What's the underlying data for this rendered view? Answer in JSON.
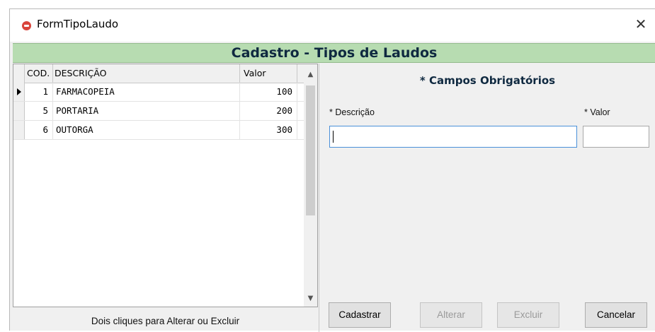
{
  "window": {
    "title": "FormTipoLaudo",
    "close_glyph": "✕",
    "icon": "app-icon",
    "colors": {
      "header_band": "#b7dcb1",
      "header_text": "#0f2940"
    }
  },
  "header": {
    "title": "Cadastro - Tipos de Laudos"
  },
  "grid": {
    "columns": [
      "COD.",
      "DESCRIÇÃO",
      "Valor"
    ],
    "rows": [
      {
        "cod": "1",
        "descricao": "FARMACOPEIA",
        "valor": "100",
        "selected": true
      },
      {
        "cod": "5",
        "descricao": "PORTARIA",
        "valor": "200",
        "selected": false
      },
      {
        "cod": "6",
        "descricao": "OUTORGA",
        "valor": "300",
        "selected": false
      }
    ],
    "scroll_up_glyph": "▲",
    "scroll_down_glyph": "▼",
    "hint": "Dois cliques para Alterar ou Excluir"
  },
  "form": {
    "required_note": "* Campos Obrigatórios",
    "descricao_label": "* Descrição",
    "valor_label": "* Valor",
    "descricao_value": "",
    "valor_value": ""
  },
  "buttons": {
    "cadastrar": "Cadastrar",
    "alterar": "Alterar",
    "excluir": "Excluir",
    "cancelar": "Cancelar"
  }
}
